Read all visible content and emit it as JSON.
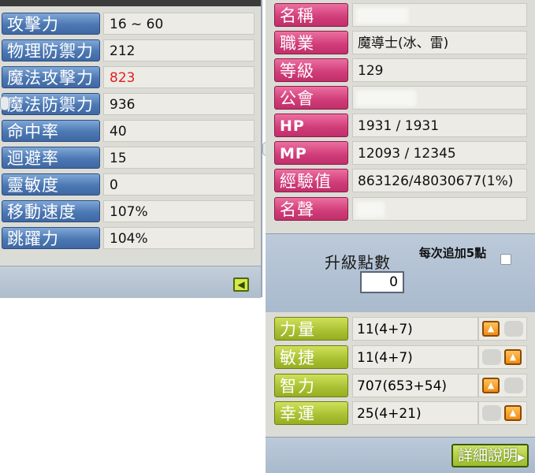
{
  "left_stats": [
    {
      "label": "攻擊力",
      "value": "16 ~ 60",
      "highlight": false
    },
    {
      "label": "物理防禦力",
      "value": "212",
      "highlight": false
    },
    {
      "label": "魔法攻擊力",
      "value": "823",
      "highlight": true
    },
    {
      "label": "魔法防禦力",
      "value": "936",
      "highlight": false
    },
    {
      "label": "命中率",
      "value": "40",
      "highlight": false
    },
    {
      "label": "迴避率",
      "value": "15",
      "highlight": false
    },
    {
      "label": "靈敏度",
      "value": "0",
      "highlight": false
    },
    {
      "label": "移動速度",
      "value": "107%",
      "highlight": false
    },
    {
      "label": "跳躍力",
      "value": "104%",
      "highlight": false
    }
  ],
  "collapse_icon": "arrow-left-icon",
  "char_info": [
    {
      "label": "名稱",
      "value": "",
      "redacted": true
    },
    {
      "label": "職業",
      "value": "魔導士(冰、雷)",
      "redacted": false
    },
    {
      "label": "等級",
      "value": "129",
      "redacted": false
    },
    {
      "label": "公會",
      "value": "",
      "redacted": true
    },
    {
      "label": "HP",
      "value": "1931 / 1931",
      "redacted": false
    },
    {
      "label": "MP",
      "value": "12093 / 12345",
      "redacted": false
    },
    {
      "label": "經驗值",
      "value": "863126/48030677(1%)",
      "redacted": false
    },
    {
      "label": "名聲",
      "value": "",
      "redacted": true
    }
  ],
  "ability_points": {
    "label": "升級點數",
    "value": "0",
    "auto_add_label": "每次追加5點",
    "auto_add_checked": false
  },
  "stats": [
    {
      "label": "力量",
      "value": "11(4+7)"
    },
    {
      "label": "敏捷",
      "value": "11(4+7)"
    },
    {
      "label": "智力",
      "value": "707(653+54)"
    },
    {
      "label": "幸運",
      "value": "25(4+21)"
    }
  ],
  "details_button": "詳細說明",
  "colors": {
    "left_label": "#4c78b3",
    "char_label": "#d03c78",
    "stat_label": "#a9c032",
    "highlight_value": "#e02020",
    "up_button": "#f08a10"
  }
}
